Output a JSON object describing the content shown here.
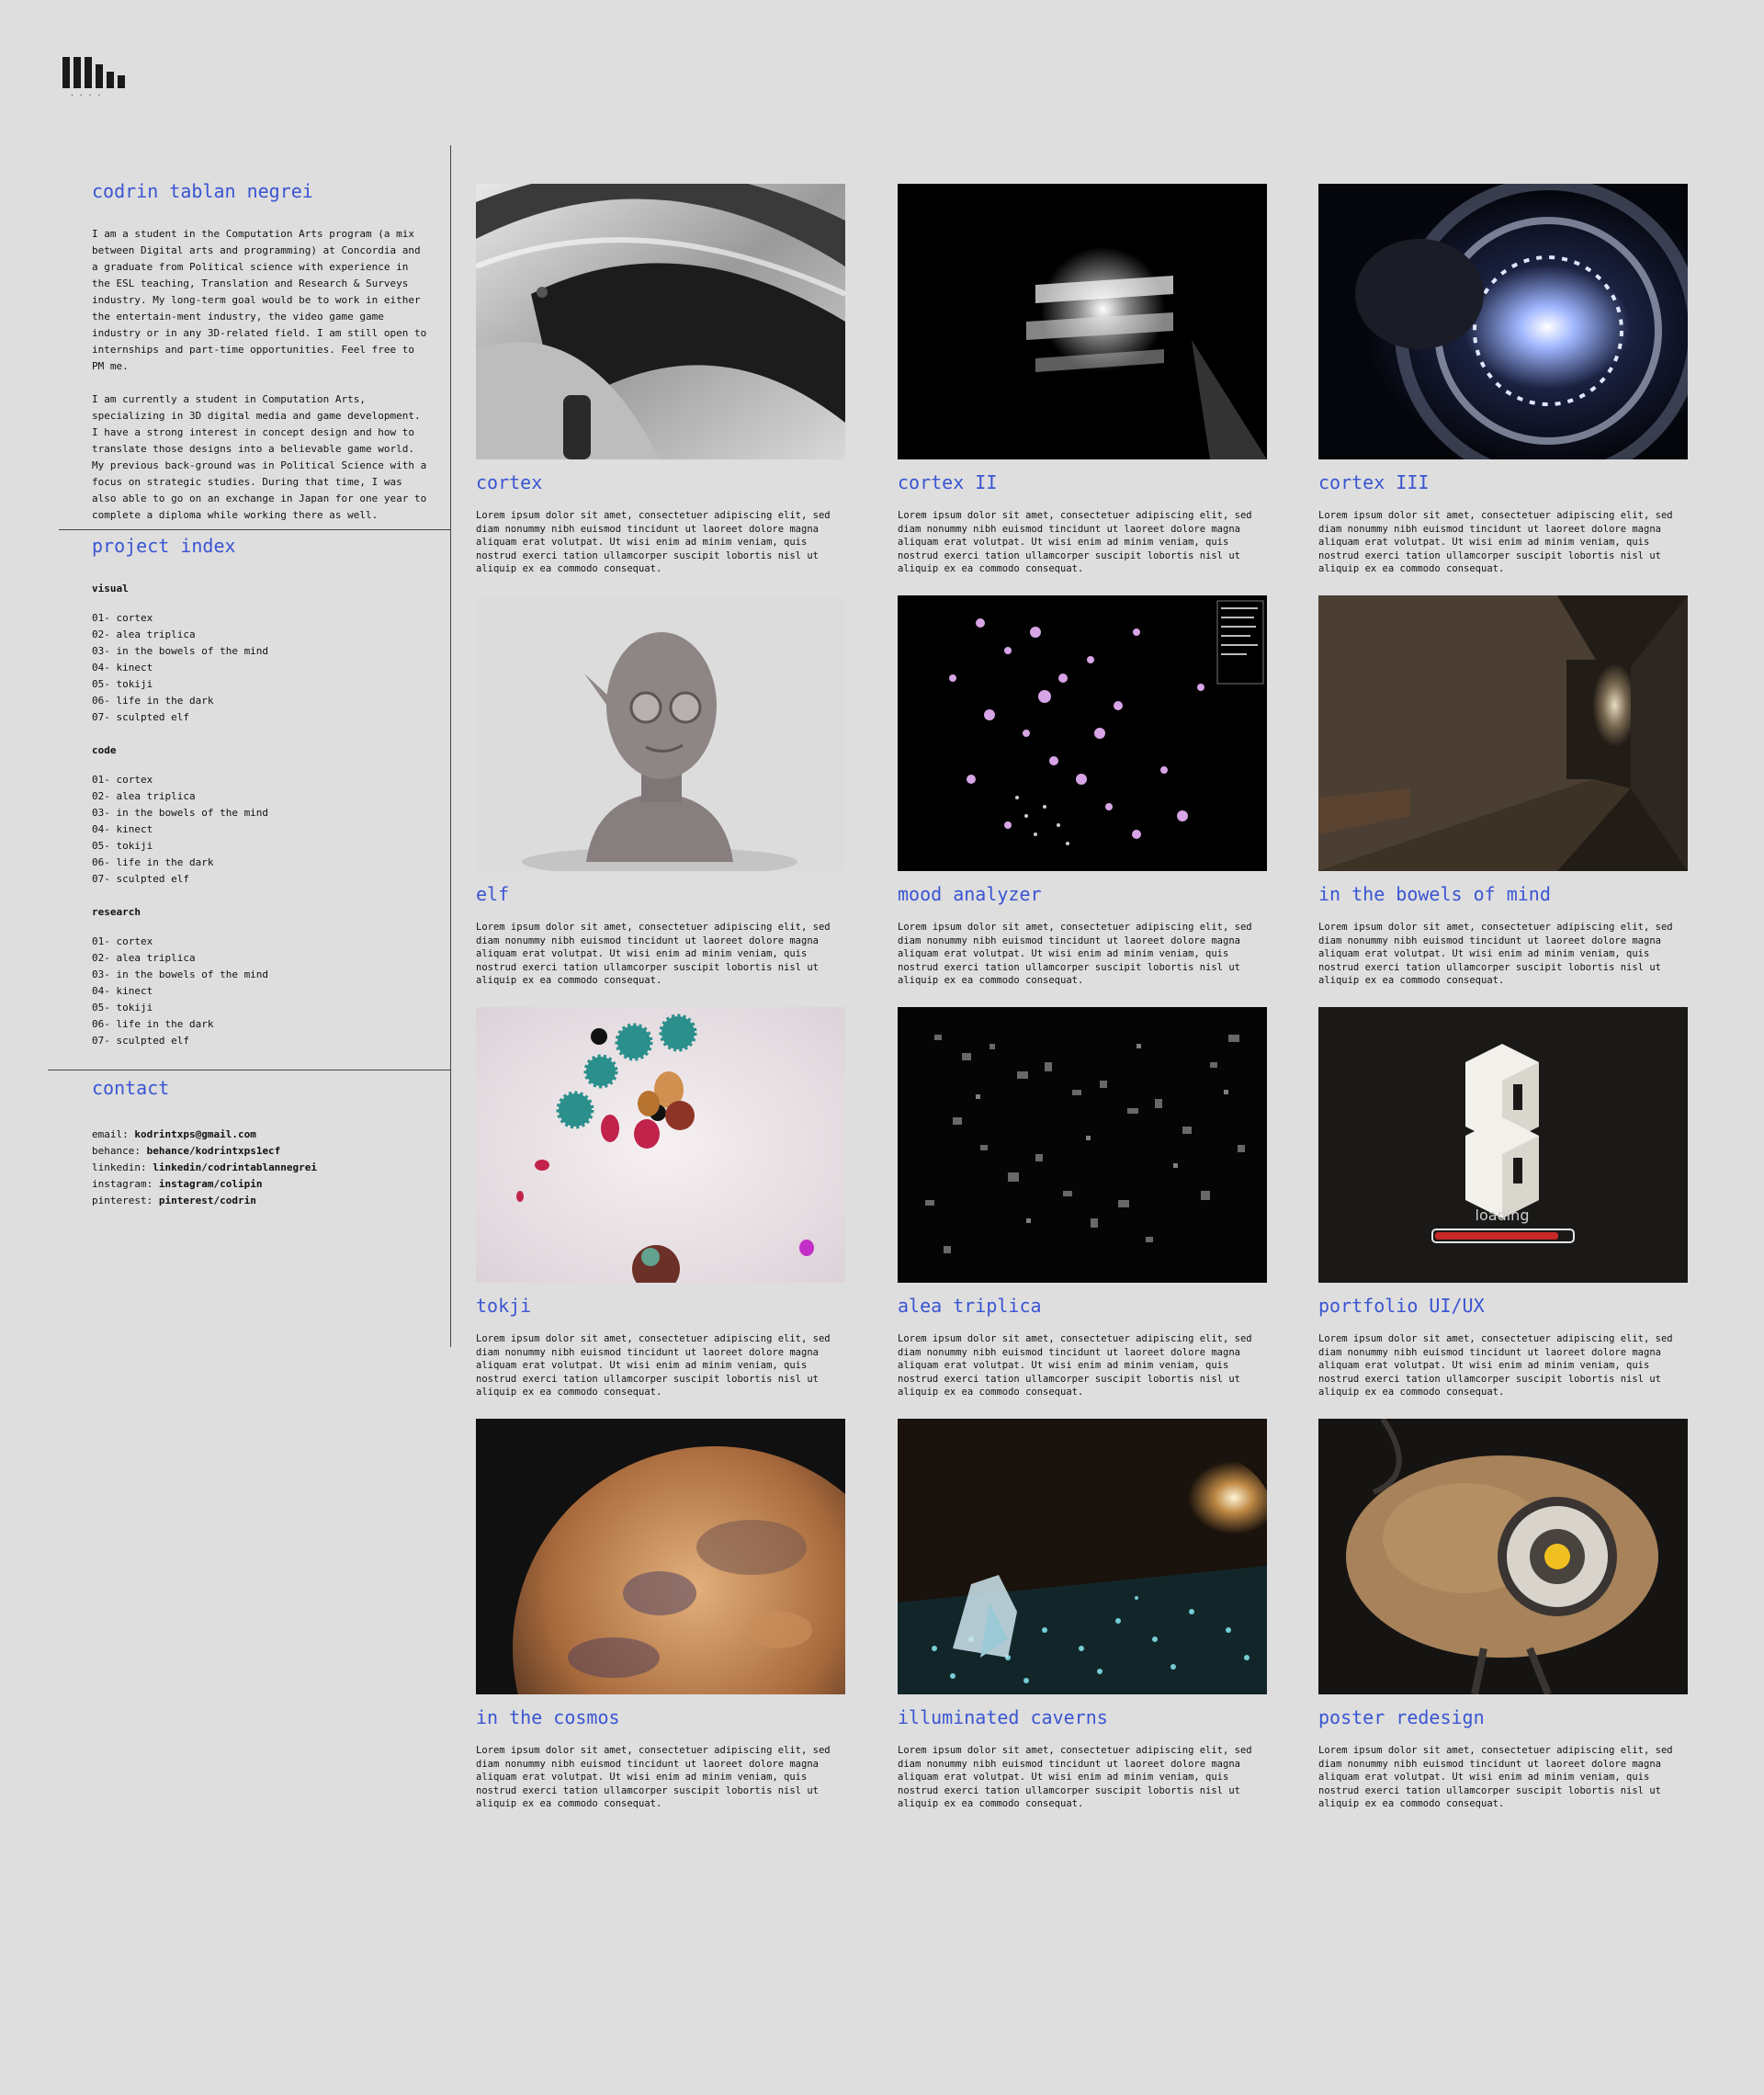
{
  "sidebar": {
    "name": "codrin tablan negrei",
    "bio": [
      "I am a student in the Computation Arts program (a mix between Digital arts and programming) at Concordia and a graduate from Political science with experience in the ESL teaching, Translation and Research & Surveys industry. My long-term goal would be to work in either the entertain-ment industry, the video game game industry or in any 3D-related field. I am still open to internships and part-time opportunities. Feel free to PM me.",
      "I am currently a student in Computation Arts, specializing in 3D digital media and game development. I have a strong interest in concept design and how to translate those designs into a believable game world. My previous back-ground was in Political Science with a focus on strategic studies. During that time, I was also able to go on an exchange in Japan for one year to complete  a diploma while working there as well."
    ],
    "index_heading": "project index",
    "groups": [
      {
        "title": "visual",
        "items": [
          "01- cortex",
          "02- alea triplica",
          "03- in the bowels of the mind",
          "04- kinect",
          "05- tokiji",
          "06- life in the dark",
          "07- sculpted elf"
        ]
      },
      {
        "title": "code",
        "items": [
          "01- cortex",
          "02- alea triplica",
          "03- in the bowels of the mind",
          "04- kinect",
          "05- tokiji",
          "06- life in the dark",
          "07- sculpted elf"
        ]
      },
      {
        "title": "research",
        "items": [
          "01- cortex",
          "02- alea triplica",
          "03- in the bowels of the mind",
          "04- kinect",
          "05- tokiji",
          "06- life in the dark",
          "07- sculpted elf"
        ]
      }
    ],
    "contact_heading": "contact",
    "contact": [
      {
        "label": "email: ",
        "value": "kodrintxps@gmail.com"
      },
      {
        "label": "behance: ",
        "value": "behance/kodrintxps1ecf"
      },
      {
        "label": "linkedin: ",
        "value": "linkedin/codrintablannegrei"
      },
      {
        "label": "instagram: ",
        "value": "instagram/colipin"
      },
      {
        "label": "pinterest: ",
        "value": "pinterest/codrin"
      }
    ]
  },
  "projects": [
    {
      "title": "cortex",
      "desc": "Lorem ipsum dolor sit amet, consectetuer adipiscing elit, sed diam nonummy nibh euismod tincidunt ut laoreet dolore magna aliquam erat volutpat. Ut wisi enim ad minim veniam, quis nostrud exerci tation ullamcorper suscipit lobortis nisl ut aliquip ex ea commodo consequat."
    },
    {
      "title": "cortex II",
      "desc": "Lorem ipsum dolor sit amet, consectetuer adipiscing elit, sed diam nonummy nibh euismod tincidunt ut laoreet dolore magna aliquam erat volutpat. Ut wisi enim ad minim veniam, quis nostrud exerci tation ullamcorper suscipit lobortis nisl ut aliquip ex ea commodo consequat."
    },
    {
      "title": "cortex III",
      "desc": "Lorem ipsum dolor sit amet, consectetuer adipiscing elit, sed diam nonummy nibh euismod tincidunt ut laoreet dolore magna aliquam erat volutpat. Ut wisi enim ad minim veniam, quis nostrud exerci tation ullamcorper suscipit lobortis nisl ut aliquip ex ea commodo consequat."
    },
    {
      "title": "elf",
      "desc": "Lorem ipsum dolor sit amet, consectetuer adipiscing elit, sed diam nonummy nibh euismod tincidunt ut laoreet dolore magna aliquam erat volutpat. Ut wisi enim ad minim veniam, quis nostrud exerci tation ullamcorper suscipit lobortis nisl ut aliquip ex ea commodo consequat."
    },
    {
      "title": "mood analyzer",
      "desc": "Lorem ipsum dolor sit amet, consectetuer adipiscing elit, sed diam nonummy nibh euismod tincidunt ut laoreet dolore magna aliquam erat volutpat. Ut wisi enim ad minim veniam, quis nostrud exerci tation ullamcorper suscipit lobortis nisl ut aliquip ex ea commodo consequat."
    },
    {
      "title": "in the bowels of mind",
      "desc": "Lorem ipsum dolor sit amet, consectetuer adipiscing elit, sed diam nonummy nibh euismod tincidunt ut laoreet dolore magna aliquam erat volutpat. Ut wisi enim ad minim veniam, quis nostrud exerci tation ullamcorper suscipit lobortis nisl ut aliquip ex ea commodo consequat."
    },
    {
      "title": "tokji",
      "desc": "Lorem ipsum dolor sit amet, consectetuer adipiscing elit, sed diam nonummy nibh euismod tincidunt ut laoreet dolore magna aliquam erat volutpat. Ut wisi enim ad minim veniam, quis nostrud exerci tation ullamcorper suscipit lobortis nisl ut aliquip ex ea commodo consequat."
    },
    {
      "title": "alea triplica",
      "desc": "Lorem ipsum dolor sit amet, consectetuer adipiscing elit, sed diam nonummy nibh euismod tincidunt ut laoreet dolore magna aliquam erat volutpat. Ut wisi enim ad minim veniam, quis nostrud exerci tation ullamcorper suscipit lobortis nisl ut aliquip ex ea commodo consequat."
    },
    {
      "title": "portfolio UI/UX",
      "desc": "Lorem ipsum dolor sit amet, consectetuer adipiscing elit, sed diam nonummy nibh euismod tincidunt ut laoreet dolore magna aliquam erat volutpat. Ut wisi enim ad minim veniam, quis nostrud exerci tation ullamcorper suscipit lobortis nisl ut aliquip ex ea commodo consequat.",
      "thumb_text": "loading"
    },
    {
      "title": "in the cosmos",
      "desc": "Lorem ipsum dolor sit amet, consectetuer adipiscing elit, sed diam nonummy nibh euismod tincidunt ut laoreet dolore magna aliquam erat volutpat. Ut wisi enim ad minim veniam, quis nostrud exerci tation ullamcorper suscipit lobortis nisl ut aliquip ex ea commodo consequat."
    },
    {
      "title": "illuminated caverns",
      "desc": "Lorem ipsum dolor sit amet, consectetuer adipiscing elit, sed diam nonummy nibh euismod tincidunt ut laoreet dolore magna aliquam erat volutpat. Ut wisi enim ad minim veniam, quis nostrud exerci tation ullamcorper suscipit lobortis nisl ut aliquip ex ea commodo consequat."
    },
    {
      "title": "poster redesign",
      "desc": "Lorem ipsum dolor sit amet, consectetuer adipiscing elit, sed diam nonummy nibh euismod tincidunt ut laoreet dolore magna aliquam erat volutpat. Ut wisi enim ad minim veniam, quis nostrud exerci tation ullamcorper suscipit lobortis nisl ut aliquip ex ea commodo consequat."
    }
  ],
  "colors": {
    "accent": "#3a55d2",
    "background": "#dedede"
  }
}
